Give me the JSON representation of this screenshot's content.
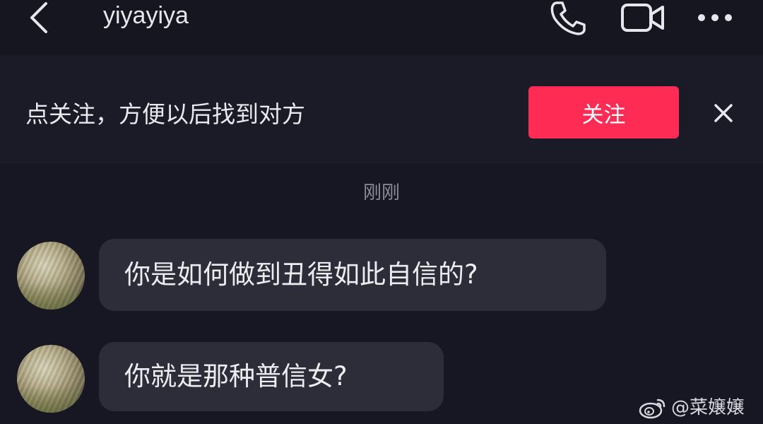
{
  "header": {
    "title": "yiyayiya",
    "icons": [
      "back-arrow-icon",
      "phone-icon",
      "video-camera-icon",
      "more-icon"
    ]
  },
  "follow_bar": {
    "tip": "点关注，方便以后找到对方",
    "button_label": "关注",
    "button_color": "#fe2c55"
  },
  "timestamp": "刚刚",
  "messages": [
    {
      "text": "你是如何做到丑得如此自信的?"
    },
    {
      "text": "你就是那种普信女?"
    }
  ],
  "watermark": {
    "text": "@菜嬢嬢"
  },
  "colors": {
    "background": "#161722",
    "bubble": "#2c2d39",
    "accent": "#fe2c55"
  }
}
